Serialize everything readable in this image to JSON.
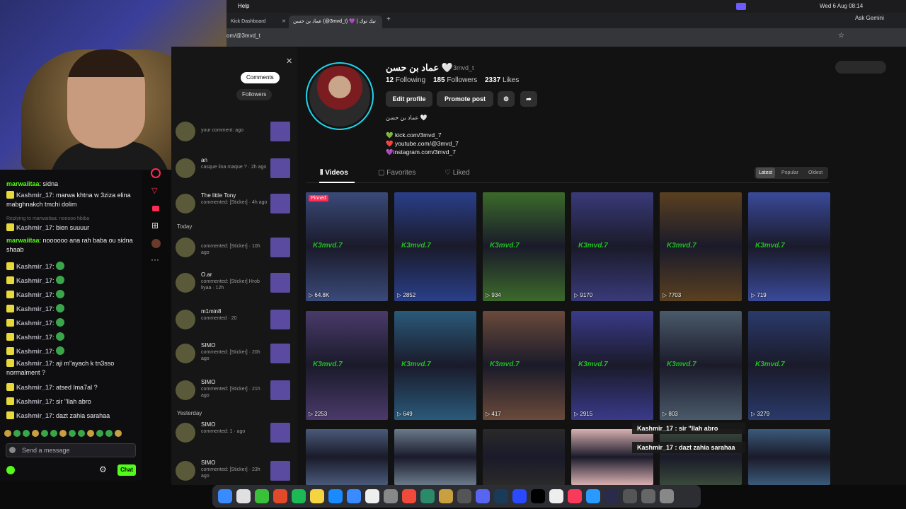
{
  "menubar": {
    "help": "Help",
    "ask": "Ask Gemini",
    "clock": "Wed 6 Aug 08:14"
  },
  "tabs": [
    {
      "label": "Kick Dashboard"
    },
    {
      "label": "عماد بن حسن (@3mvd_t) 💜 | تيك توك"
    }
  ],
  "address": {
    "url": "om/@3mvd_t"
  },
  "chat": {
    "messages": [
      {
        "user": "marwaiitaa",
        "text": "sidna",
        "green": false
      },
      {
        "user": "Kashmir_17",
        "text": "marwa khtna w 3ziza elina mabghnakch tmchi dolim",
        "green": false
      },
      {
        "user": "",
        "text": "Replying to marwaiitaa: nooooo hbiba",
        "system": true
      },
      {
        "user": "Kashmir_17",
        "text": "bien suuuur",
        "green": false
      },
      {
        "user": "marwaiitaa",
        "text": "noooooo ana rah baba ou sidna shaab",
        "green": false
      },
      {
        "user": "Kashmir_17",
        "text": "",
        "green": false
      },
      {
        "user": "Kashmir_17",
        "text": "",
        "green": false
      },
      {
        "user": "Kashmir_17",
        "text": "",
        "green": false
      },
      {
        "user": "Kashmir_17",
        "text": "",
        "green": false
      },
      {
        "user": "Kashmir_17",
        "text": "",
        "green": false
      },
      {
        "user": "Kashmir_17",
        "text": "",
        "green": false
      },
      {
        "user": "Kashmir_17",
        "text": "",
        "green": false
      },
      {
        "user": "Kashmir_17",
        "text": "aji m\"ayach k tn3sso normalment ?",
        "green": false
      },
      {
        "user": "Kashmir_17",
        "text": "atsed lma7al ?",
        "green": false
      },
      {
        "user": "Kashmir_17",
        "text": "sir \"llah abro",
        "green": false
      },
      {
        "user": "Kashmir_17",
        "text": "dazt zahia sarahaa",
        "green": false
      }
    ],
    "input_placeholder": "Send a message",
    "send_label": "Chat"
  },
  "notifications": {
    "filters": [
      "Comments",
      "Followers"
    ],
    "sections": [
      "Today",
      "Yesterday"
    ],
    "items": [
      {
        "name": "",
        "sub": "your comment: ago"
      },
      {
        "name": "an",
        "sub": "casque lina maque ? · 2h ago"
      },
      {
        "name": "The little Tony",
        "sub": "commented: [Sticker] · 4h ago"
      },
      {
        "name": "",
        "sub": "commented: [Sticker] · 10h ago"
      },
      {
        "name": "O.ar",
        "sub": "commented: [Sticker] Hrob liyaa · 12h"
      },
      {
        "name": "m1min8",
        "sub": "commented · 20"
      },
      {
        "name": "SIMO",
        "sub": "commented: [Sticker] · 20h ago"
      },
      {
        "name": "SIMO",
        "sub": "commented: [Sticker] · 21h ago"
      },
      {
        "name": "SIMO",
        "sub": "commented: 1 · ago"
      },
      {
        "name": "SIMO",
        "sub": "commented: [Sticker] · 23h ago"
      }
    ]
  },
  "profile": {
    "display_name": "عماد بن حسن 🤍",
    "handle": "3mvd_t",
    "following_count": "12",
    "following_label": "Following",
    "followers_count": "185",
    "followers_label": "Followers",
    "likes_count": "2337",
    "likes_label": "Likes",
    "edit_label": "Edit profile",
    "promote_label": "Promote post",
    "bio": "عماد بن حسن 🤍",
    "links": [
      "💚 kick.com/3mvd_7",
      "❤️ youtube.com/@3mvd_7",
      "💜instagram.com/3mvd_7"
    ]
  },
  "content_tabs": {
    "videos": "Videos",
    "favorites": "Favorites",
    "liked": "Liked"
  },
  "sort": {
    "latest": "Latest",
    "popular": "Popular",
    "oldest": "Oldest"
  },
  "videos": [
    {
      "views": "64.8K",
      "pinned": "Pinned",
      "color": "#3a4a7a"
    },
    {
      "views": "2852",
      "color": "#2a3f8a"
    },
    {
      "views": "934",
      "color": "#3b6a2a"
    },
    {
      "views": "9170",
      "color": "#3a3a7a"
    },
    {
      "views": "7703",
      "color": "#5a4020"
    },
    {
      "views": "719",
      "color": "#3a4a9a"
    },
    {
      "views": "2253",
      "color": "#4a3a6a"
    },
    {
      "views": "649",
      "color": "#2a5a7a"
    },
    {
      "views": "417",
      "color": "#6a4a3a"
    },
    {
      "views": "2915",
      "color": "#3a3a8a"
    },
    {
      "views": "803",
      "color": "#4a5a6a"
    },
    {
      "views": "3279",
      "color": "#2a3a6a"
    },
    {
      "views": "",
      "color": "#4a5a7a"
    },
    {
      "views": "",
      "color": "#6a7a8a"
    },
    {
      "views": "",
      "color": "#2a2a2a"
    },
    {
      "views": "",
      "color": "#d8b0b0"
    },
    {
      "views": "",
      "color": "#3a4a3a"
    },
    {
      "views": "",
      "color": "#3a5a7a"
    }
  ],
  "video_overlay_text": "K3mvd.7",
  "overlay": [
    "Kashmir_17 : sir \"llah abro",
    "Kashmir_17 : dazt zahia sarahaa"
  ]
}
